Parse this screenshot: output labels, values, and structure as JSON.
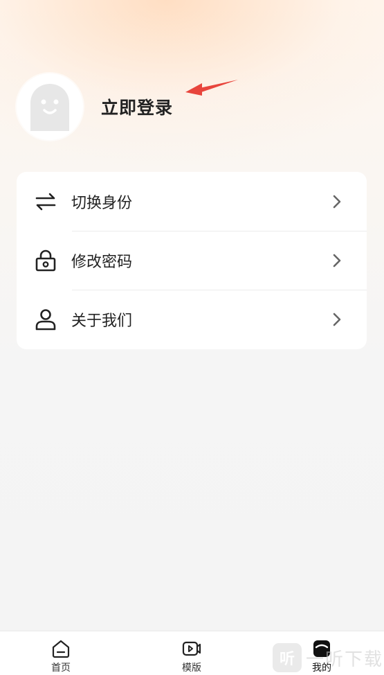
{
  "profile": {
    "login_label": "立即登录",
    "avatar_icon": "ghost-avatar-icon"
  },
  "menu": {
    "items": [
      {
        "label": "切换身份",
        "icon": "swap-arrows-icon"
      },
      {
        "label": "修改密码",
        "icon": "lock-icon"
      },
      {
        "label": "关于我们",
        "icon": "user-icon"
      }
    ]
  },
  "tabbar": {
    "tabs": [
      {
        "label": "首页",
        "icon": "home-icon",
        "active": false
      },
      {
        "label": "模版",
        "icon": "video-template-icon",
        "active": false
      },
      {
        "label": "我的",
        "icon": "profile-box-icon",
        "active": true
      }
    ]
  },
  "watermark": {
    "badge": "听",
    "text": "一听下载"
  },
  "colors": {
    "annotation_arrow": "#e8453c",
    "text_primary": "#222222",
    "card_bg": "#ffffff"
  }
}
